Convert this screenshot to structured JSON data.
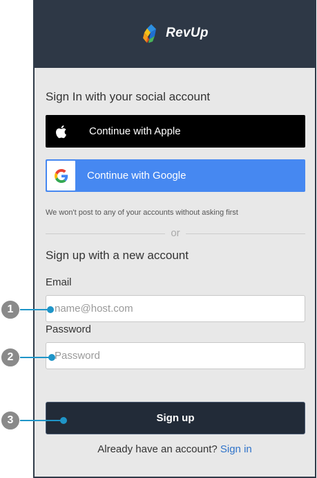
{
  "header": {
    "brand_name": "RevUp"
  },
  "social": {
    "title": "Sign In with your social account",
    "apple_label": "Continue with Apple",
    "google_label": "Continue with Google",
    "disclaimer": "We won't post to any of your accounts without asking first",
    "divider_text": "or"
  },
  "signup": {
    "title": "Sign up with a new account",
    "email_label": "Email",
    "email_placeholder": "name@host.com",
    "email_value": "",
    "password_label": "Password",
    "password_placeholder": "Password",
    "password_value": "",
    "button_label": "Sign up",
    "have_account_text": "Already have an account?",
    "signin_link": "Sign in"
  },
  "callouts": [
    "1",
    "2",
    "3"
  ],
  "colors": {
    "header_bg": "#2e3846",
    "google_blue": "#4688f1",
    "signup_button": "#222b38",
    "callout_line": "#1f95c8",
    "link": "#2f73c9"
  },
  "icons": {
    "apple": "apple-icon",
    "google": "google-icon",
    "brand": "revup-logo-icon"
  }
}
